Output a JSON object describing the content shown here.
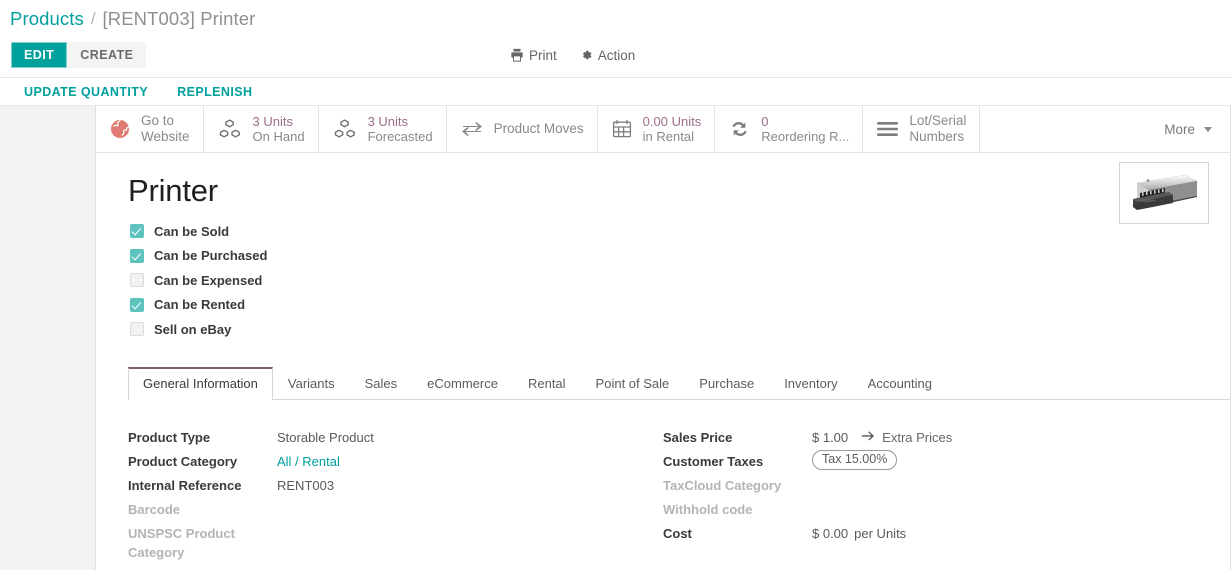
{
  "breadcrumb": {
    "root": "Products",
    "separator": "/",
    "current": "[RENT003] Printer"
  },
  "toolbar": {
    "edit_label": "EDIT",
    "create_label": "CREATE",
    "print_label": "Print",
    "print_icon": "printer-icon",
    "action_label": "Action",
    "action_icon": "gear-icon"
  },
  "action_bar": {
    "links": [
      {
        "label": "UPDATE QUANTITY"
      },
      {
        "label": "REPLENISH"
      }
    ]
  },
  "stat_buttons": [
    {
      "icon": "globe-icon",
      "value": "",
      "label": "Go to",
      "label2": "Website",
      "single": true
    },
    {
      "icon": "cubes-icon",
      "value": "3 Units",
      "label": "On Hand",
      "single": false
    },
    {
      "icon": "cubes-icon",
      "value": "3 Units",
      "label": "Forecasted",
      "single": false
    },
    {
      "icon": "exchange-arrows-icon",
      "value": "",
      "label": "Product Moves",
      "single": true
    },
    {
      "icon": "calendar-icon",
      "value": "0.00 Units",
      "label": "in Rental",
      "single": false
    },
    {
      "icon": "refresh-icon",
      "value": "0",
      "label": "Reordering R...",
      "single": false
    },
    {
      "icon": "bars-icon",
      "value": "",
      "label": "Lot/Serial",
      "label2": "Numbers",
      "single": true
    }
  ],
  "more_button": {
    "label": "More",
    "icon": "chevron-down-icon"
  },
  "product": {
    "title": "Printer",
    "image_alt": "printer-photo"
  },
  "checkboxes": [
    {
      "label": "Can be Sold",
      "checked": true
    },
    {
      "label": "Can be Purchased",
      "checked": true
    },
    {
      "label": "Can be Expensed",
      "checked": false
    },
    {
      "label": "Can be Rented",
      "checked": true
    },
    {
      "label": "Sell on eBay",
      "checked": false
    }
  ],
  "tabs": [
    {
      "label": "General Information",
      "active": true
    },
    {
      "label": "Variants",
      "active": false
    },
    {
      "label": "Sales",
      "active": false
    },
    {
      "label": "eCommerce",
      "active": false
    },
    {
      "label": "Rental",
      "active": false
    },
    {
      "label": "Point of Sale",
      "active": false
    },
    {
      "label": "Purchase",
      "active": false
    },
    {
      "label": "Inventory",
      "active": false
    },
    {
      "label": "Accounting",
      "active": false
    }
  ],
  "form": {
    "left": [
      {
        "label": "Product Type",
        "value": "Storable Product",
        "muted_label": false,
        "link": false
      },
      {
        "label": "Product Category",
        "value": "All / Rental",
        "muted_label": false,
        "link": true
      },
      {
        "label": "Internal Reference",
        "value": "RENT003",
        "muted_label": false,
        "link": false
      },
      {
        "label": "Barcode",
        "value": "",
        "muted_label": true,
        "link": false
      },
      {
        "label": "UNSPSC Product Category",
        "value": "",
        "muted_label": true,
        "link": false
      }
    ],
    "right": {
      "sales_price_label": "Sales Price",
      "sales_price_value": "$ 1.00",
      "extra_prices_label": "Extra Prices",
      "extra_prices_icon": "arrow-right-icon",
      "customer_taxes_label": "Customer Taxes",
      "customer_taxes_value": "Tax 15.00%",
      "taxcloud_label": "TaxCloud Category",
      "taxcloud_value": "",
      "withhold_label": "Withhold code",
      "withhold_value": "",
      "cost_label": "Cost",
      "cost_value": "$ 0.00",
      "cost_suffix": "per Units"
    }
  },
  "colors": {
    "accent": "#00a09d",
    "stat_value": "#9d6d8c",
    "checkbox_on": "#5ec3bf",
    "globe_icon": "#e07b73",
    "tab_active_top": "#7c5a6a"
  }
}
